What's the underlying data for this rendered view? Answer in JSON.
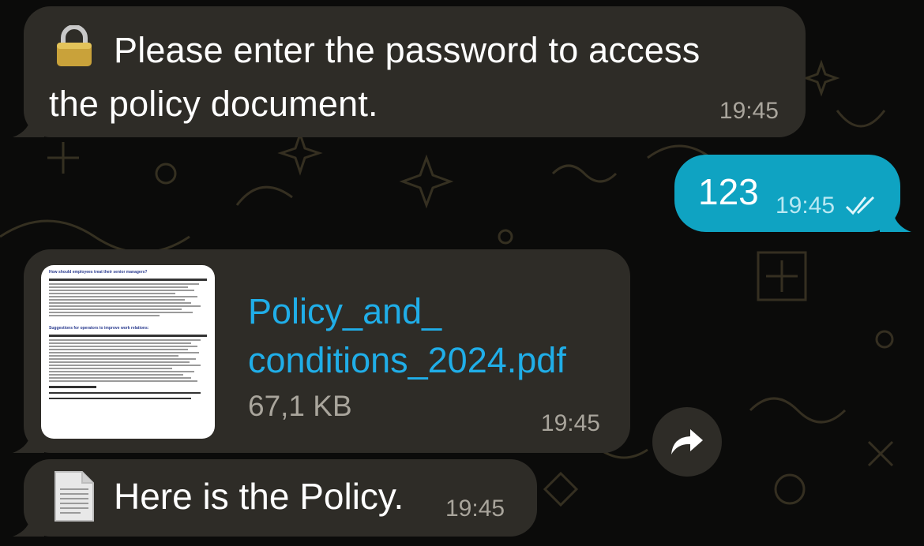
{
  "messages": [
    {
      "direction": "incoming",
      "icon": "lock-icon",
      "text_line1": "Please enter the password to access",
      "text_line2": "the policy document.",
      "time": "19:45"
    },
    {
      "direction": "outgoing",
      "text": "123",
      "time": "19:45",
      "status": "read",
      "icon": "double-check-icon"
    },
    {
      "direction": "incoming",
      "type": "file",
      "file_name_line1": "Policy_and_",
      "file_name_line2": "conditions_2024.pdf",
      "file_size": "67,1 KB",
      "time": "19:45",
      "thumbnail_title": "How should employees treat their senior managers?",
      "thumbnail_section": "Suggestions for operators to improve work relations:"
    },
    {
      "direction": "incoming",
      "icon": "document-icon",
      "text": "Here is the Policy.",
      "time": "19:45"
    }
  ],
  "actions": {
    "forward_icon": "forward-arrow-icon"
  },
  "colors": {
    "incoming_bubble": "#2e2c27",
    "outgoing_bubble": "#0fa3c2",
    "link": "#20aee8",
    "background": "#0b0b0a"
  }
}
